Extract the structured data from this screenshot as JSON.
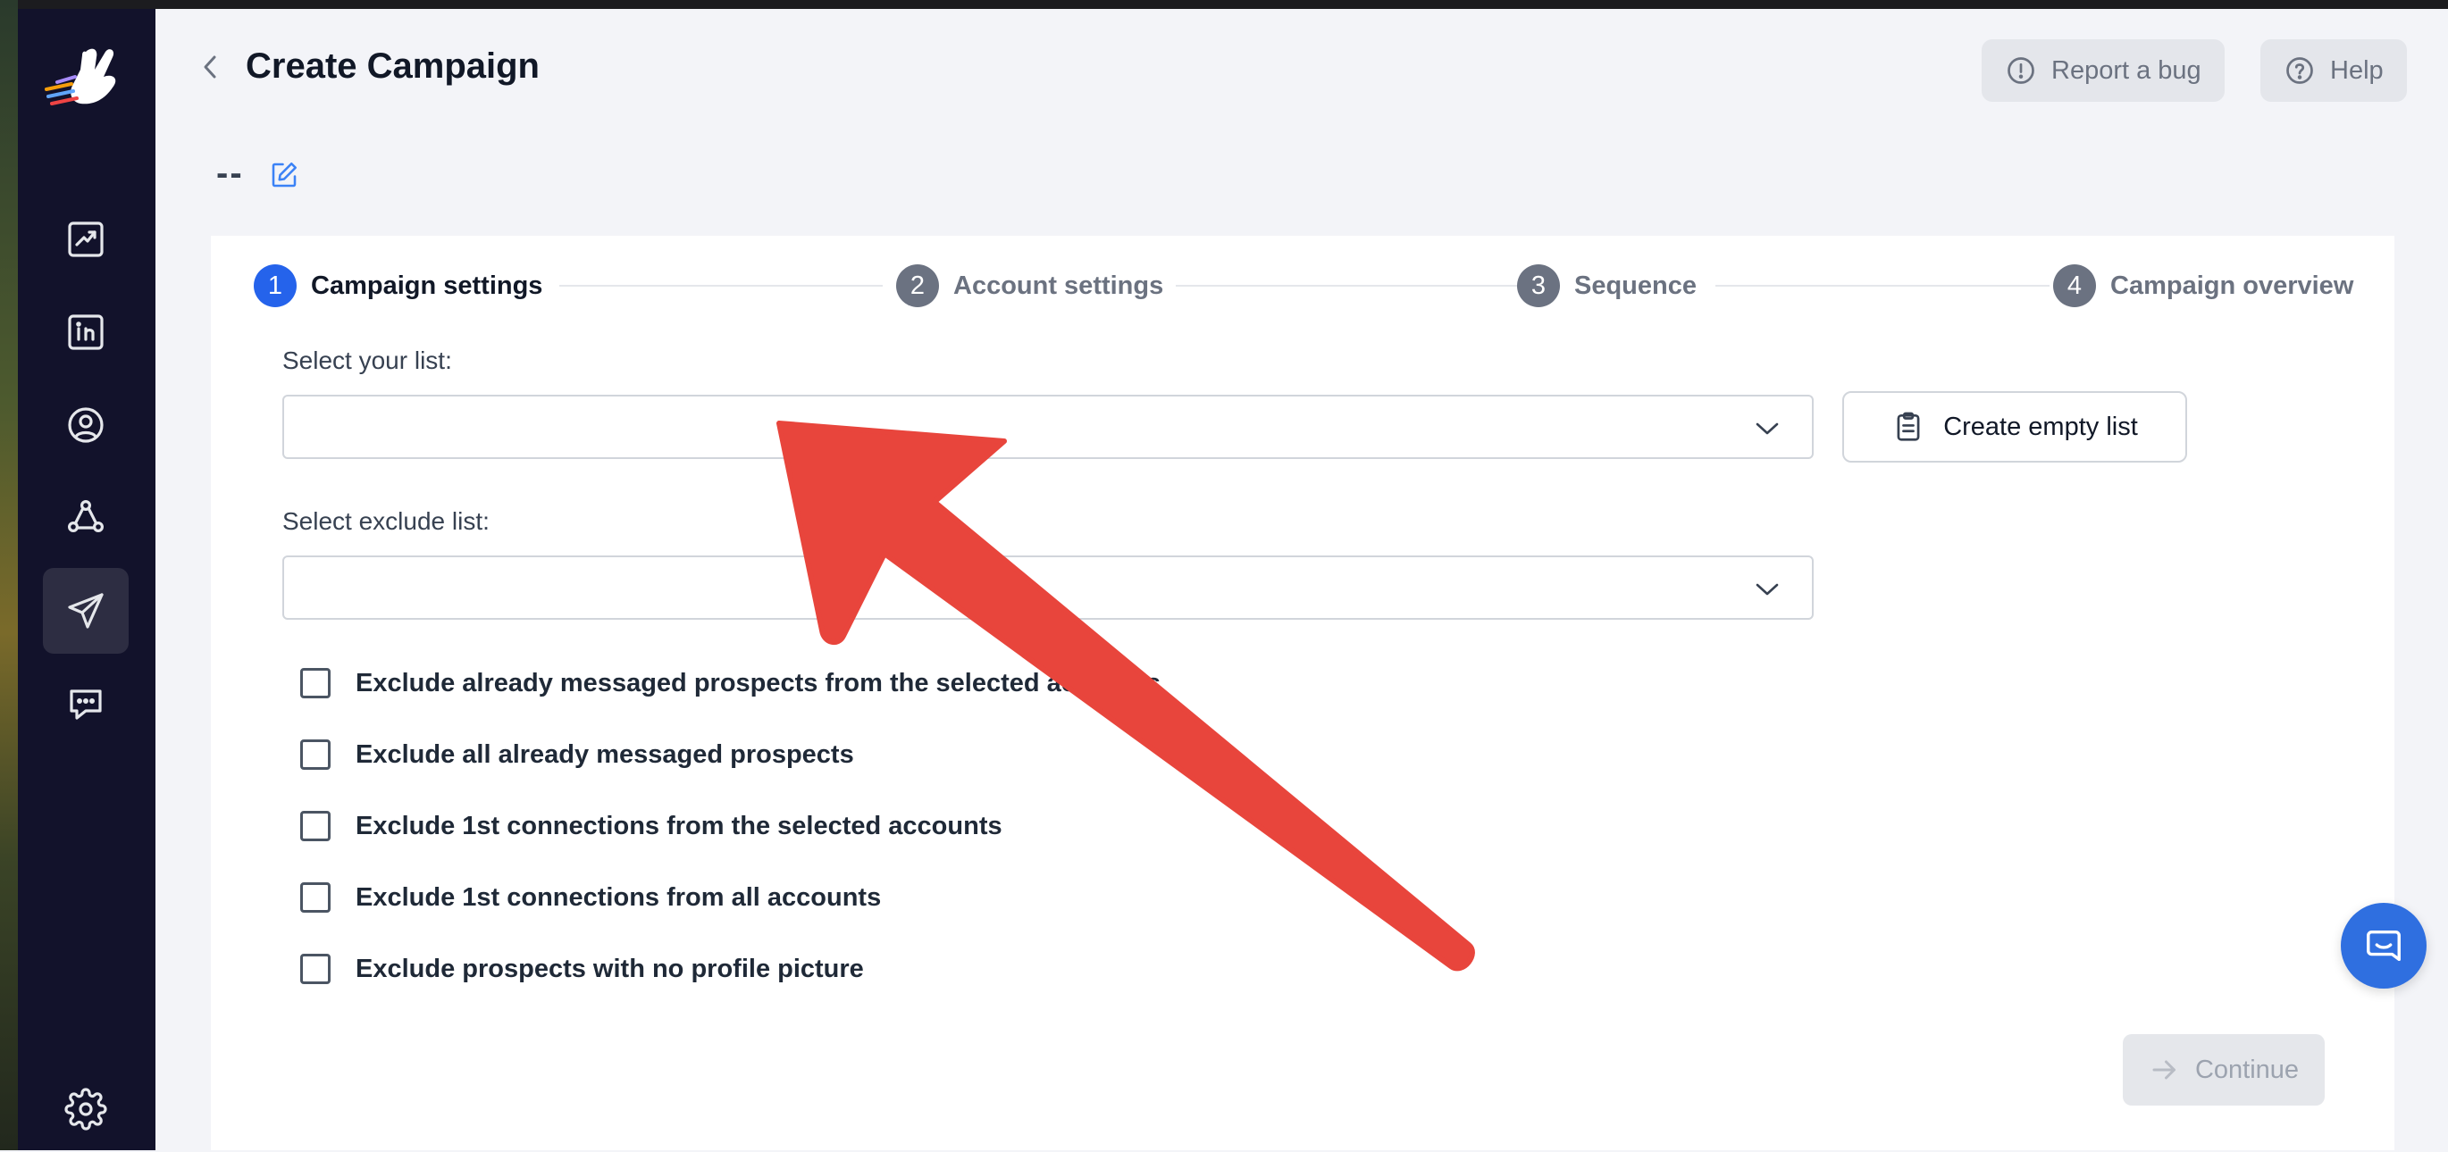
{
  "header": {
    "title": "Create Campaign",
    "report_bug_label": "Report a bug",
    "help_label": "Help"
  },
  "campaign": {
    "name": "--"
  },
  "steps": [
    {
      "number": "1",
      "label": "Campaign settings",
      "active": true
    },
    {
      "number": "2",
      "label": "Account settings",
      "active": false
    },
    {
      "number": "3",
      "label": "Sequence",
      "active": false
    },
    {
      "number": "4",
      "label": "Campaign overview",
      "active": false
    }
  ],
  "form": {
    "select_list_label": "Select your list:",
    "select_list_value": "",
    "exclude_list_label": "Select exclude list:",
    "exclude_list_value": "",
    "create_empty_list_label": "Create empty list",
    "checkboxes": [
      {
        "label": "Exclude already messaged prospects from the selected accounts",
        "checked": false
      },
      {
        "label": "Exclude all already messaged prospects",
        "checked": false
      },
      {
        "label": "Exclude 1st connections from the selected accounts",
        "checked": false
      },
      {
        "label": "Exclude 1st connections from all accounts",
        "checked": false
      },
      {
        "label": "Exclude prospects with no profile picture",
        "checked": false
      }
    ],
    "continue_label": "Continue"
  },
  "sidebar": {
    "items": [
      {
        "icon": "analytics-icon"
      },
      {
        "icon": "linkedin-icon"
      },
      {
        "icon": "user-icon"
      },
      {
        "icon": "network-icon"
      },
      {
        "icon": "send-icon",
        "active": true
      },
      {
        "icon": "chat-icon"
      },
      {
        "icon": "settings-icon"
      }
    ]
  },
  "colors": {
    "sidebar_bg": "#12122b",
    "active_step": "#2563eb",
    "inactive_step": "#6b7281",
    "annotation_arrow": "#e8453c",
    "chat_fab": "#2f6fe0"
  }
}
